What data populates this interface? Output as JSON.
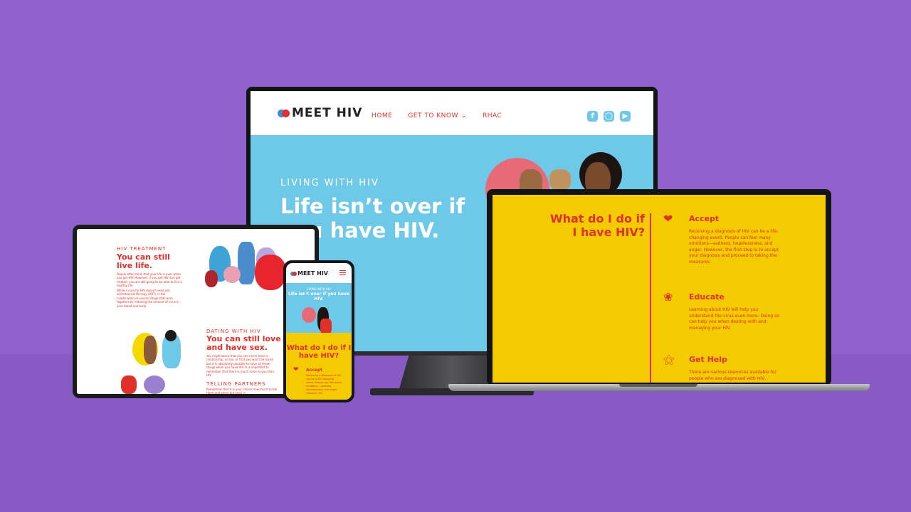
{
  "brand": {
    "logo_text": "MEET HIV",
    "colors": {
      "background": "#8f62cc",
      "sky": "#6ec9e8",
      "yellow": "#f3cb00",
      "red": "#e0302a"
    }
  },
  "monitor": {
    "nav": {
      "links": [
        {
          "label": "HOME"
        },
        {
          "label": "GET TO KNOW",
          "has_dropdown": true
        },
        {
          "label": "RHAC"
        }
      ],
      "social_icons": [
        "facebook-icon",
        "instagram-icon",
        "youtube-icon"
      ]
    },
    "hero": {
      "kicker": "LIVING WITH HIV",
      "title": "Life isn’t over if you have HIV."
    }
  },
  "laptop": {
    "title": "What do I do if I have HIV?",
    "items": [
      {
        "icon": "heart-icon",
        "heading": "Accept",
        "text": "Receiving a diagnosis of HIV can be a life-changing event. People can feel many emotions—sadness, hopelessness, and anger. However, the first step is to accept your diagnosis and proceed to taking the measures."
      },
      {
        "icon": "brain-icon",
        "heading": "Educate",
        "text": "Learning about HIV will help you understand the virus even more. Doing so can help you when dealing with and managing your HIV."
      },
      {
        "icon": "handshake-icon",
        "heading": "Get Help",
        "text": "There are various resources available for people who are diagnosed with HIV, whether it be medical services"
      }
    ]
  },
  "tablet": {
    "section1": {
      "kicker": "HIV TREATMENT",
      "heading": "You can still live life.",
      "p1": "People often think that your life is over when you get HIV. However, if you get HIV and get treated, you are still going to be able to live a healthy life.",
      "p2": "While a cure for HIV doesn't exist yet, antiretroviral therapy (ART), is the combination of several drugs that work together by reducing the amount of virus in your blood and body."
    },
    "section2": {
      "kicker": "DATING WITH HIV",
      "heading": "You can still love and have sex.",
      "p1": "You might worry that you can never have a relationship, or sex, or that you won't be loved but it is absolutely possible to have all these things when you have HIV. It is important to remember that there is much more to you than HIV."
    },
    "section3": {
      "kicker": "TELLING PARTNERS",
      "p1": "Remember that it is your choice how much to tell them and when but keep in"
    }
  },
  "phone": {
    "hero": {
      "kicker": "LIVING WITH HIV",
      "title": "Life isn't over if you have HIV."
    },
    "question": "What do I do if I have HIV?",
    "item": {
      "heading": "Accept",
      "text": "Receiving a diagnosis of HIV can be a life-changing event. People can feel many emotions —sadness, hopelessness, and anger. However, the"
    }
  }
}
